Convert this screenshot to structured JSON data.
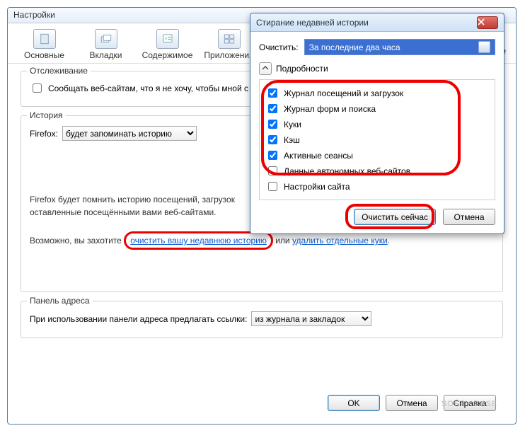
{
  "window": {
    "title": "Настройки"
  },
  "toolbar": {
    "items": [
      {
        "label": "Основные"
      },
      {
        "label": "Вкладки"
      },
      {
        "label": "Содержимое"
      },
      {
        "label": "Приложения"
      }
    ],
    "cutoff_label": "ые"
  },
  "tracking": {
    "title": "Отслеживание",
    "dnt_label": "Сообщать веб-сайтам, что я не хочу, чтобы мной с"
  },
  "history": {
    "title": "История",
    "firefox_label": "Firefox:",
    "mode_value": "будет запоминать историю",
    "body1": "Firefox будет помнить историю посещений, загрузок",
    "body2": "оставленные посещёнными вами веб-сайтами.",
    "maybe_prefix": "Возможно, вы захотите ",
    "link_clear": "очистить вашу недавнюю историю",
    "or": " или ",
    "link_cookies": "удалить отдельные куки",
    "period": "."
  },
  "addressbar": {
    "title": "Панель адреса",
    "label": "При использовании панели адреса предлагать ссылки:",
    "value": "из журнала и закладок"
  },
  "buttons": {
    "ok": "OK",
    "cancel": "Отмена",
    "help": "Справка"
  },
  "modal": {
    "title": "Стирание недавней истории",
    "clear_label": "Очистить:",
    "range_value": "За последние два часа",
    "details": "Подробности",
    "items": [
      {
        "label": "Журнал посещений и загрузок",
        "checked": true
      },
      {
        "label": "Журнал форм и поиска",
        "checked": true
      },
      {
        "label": "Куки",
        "checked": true
      },
      {
        "label": "Кэш",
        "checked": true
      },
      {
        "label": "Активные сеансы",
        "checked": true
      },
      {
        "label": "Данные автономных веб-сайтов",
        "checked": false
      },
      {
        "label": "Настройки сайта",
        "checked": false
      }
    ],
    "clear_now": "Очистить сейчас",
    "cancel": "Отмена"
  },
  "watermark": "SOFT - BASE"
}
